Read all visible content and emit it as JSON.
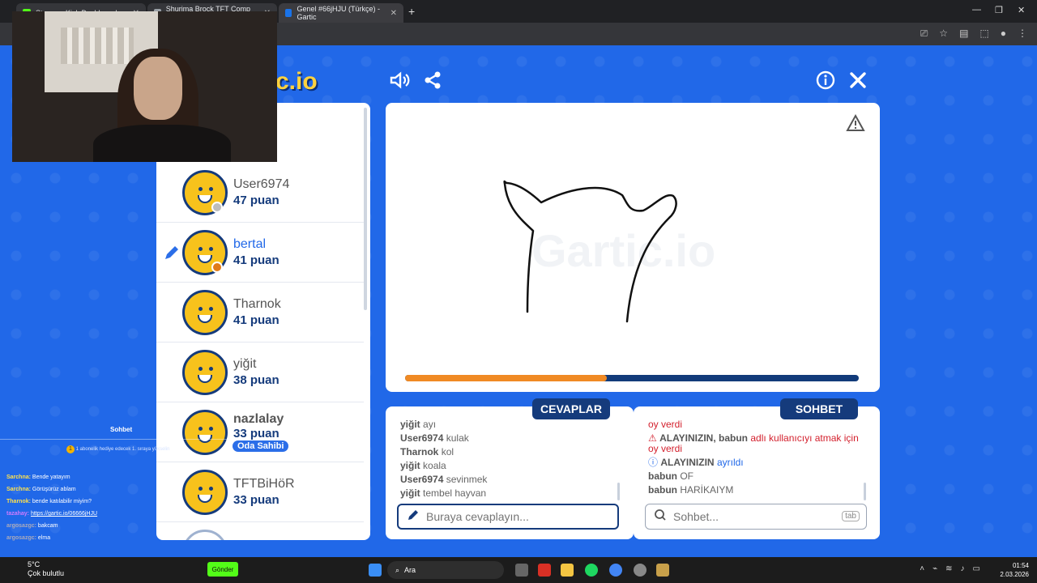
{
  "browser": {
    "tabs": [
      {
        "label": "Stream - Kick Dashboard",
        "color": "#53fc18"
      },
      {
        "label": "Shurima Brock TFT Comp Guide",
        "color": "#9aa0a6"
      },
      {
        "label": "Genel #66jHJU (Türkçe) - Gartic",
        "color": "#1a73e8"
      }
    ]
  },
  "game": {
    "logo": "c.io",
    "top_icons": [
      "volume-icon",
      "share-icon",
      "info-icon",
      "close-icon"
    ],
    "players": [
      {
        "name": "User6974",
        "score": "47 puan",
        "status_color": "#bdbdbd",
        "drawing": false
      },
      {
        "name": "bertal",
        "score": "41 puan",
        "status_color": "#e07b1a",
        "drawing": true
      },
      {
        "name": "Tharnok",
        "score": "41 puan",
        "status_color": "",
        "drawing": false
      },
      {
        "name": "yiğit",
        "score": "38 puan",
        "status_color": "",
        "drawing": false
      },
      {
        "name": "nazlalay",
        "score": "33 puan",
        "status_color": "",
        "drawing": false,
        "badge": "Oda Sahibi"
      },
      {
        "name": "TFTBiHöR",
        "score": "33 puan",
        "status_color": "",
        "drawing": false
      }
    ],
    "canvas_watermark": "Gartic.io",
    "timer_progress": 0.445,
    "answers_tab": "CEVAPLAR",
    "chat_tab": "SOHBET",
    "answers": [
      {
        "user": "yiğit",
        "text": "ayı"
      },
      {
        "user": "User6974",
        "text": "kulak"
      },
      {
        "user": "Tharnok",
        "text": "kol"
      },
      {
        "user": "yiğit",
        "text": "koala"
      },
      {
        "user": "User6974",
        "text": "sevinmek"
      },
      {
        "user": "yiğit",
        "text": "tembel hayvan"
      }
    ],
    "answer_placeholder": "Buraya cevaplayın...",
    "chat": {
      "line1": "oy verdi",
      "alert_label": "ALAYINIZIN,",
      "alert_user": "babun",
      "alert_rest": "adlı kullanıcıyı atmak için oy verdi",
      "info_label": "ALAYINIZIN",
      "info_rest": "ayrıldı",
      "msg1_user": "babun",
      "msg1_text": "OF",
      "msg2_user": "babun",
      "msg2_text": "HARİKAIYM"
    },
    "chat_placeholder": "Sohbet...",
    "chat_tab_key": "tab"
  },
  "stream_chat": {
    "title": "Sohbet",
    "sub_notice": "1 abonelik hediye edecek 1. sıraya yükselin",
    "messages": [
      {
        "user": "Sarchna:",
        "text": "Bende yatayım"
      },
      {
        "user": "Sarchna:",
        "text": "Görüşürüz ablam"
      },
      {
        "user": "Tharnok:",
        "text": "bende katılabilir miyim?"
      },
      {
        "user": "tazahay:",
        "text": "https://gartic.io/06666jHJU"
      },
      {
        "user": "argosazgc:",
        "text": "bakcam"
      },
      {
        "user": "argosazgc:",
        "text": "elma"
      }
    ]
  },
  "taskbar": {
    "weather_temp": "5°C",
    "weather_desc": "Çok bulutlu",
    "send_label": "Gönder",
    "search_label": "Ara",
    "time": "01:54",
    "date": "2.03.2026"
  }
}
